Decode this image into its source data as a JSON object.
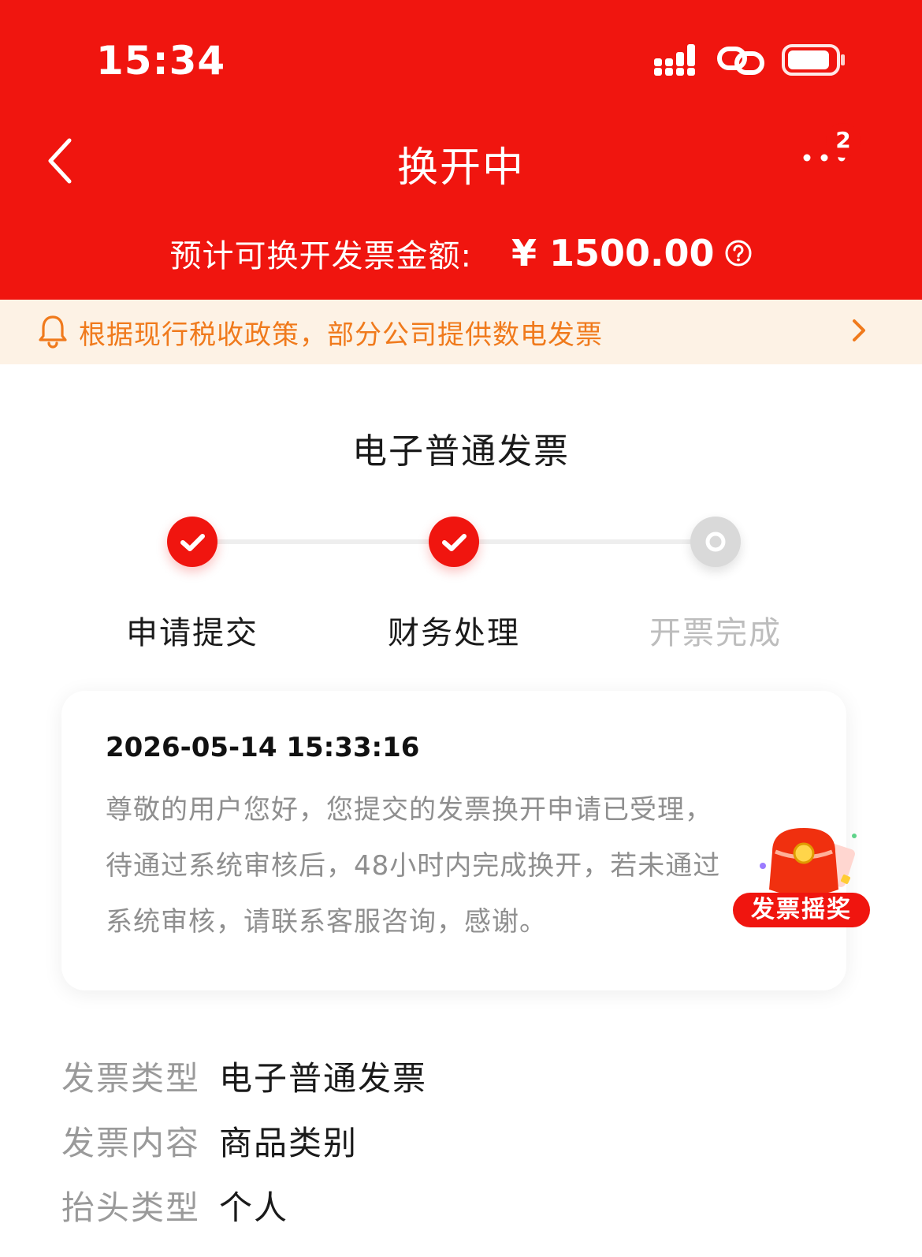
{
  "status_bar": {
    "time": "15:34"
  },
  "nav": {
    "title": "换开中",
    "more_badge": "2"
  },
  "amount": {
    "label": "预计可换开发票金额:",
    "value": "¥ 1500.00"
  },
  "notice": {
    "text": "根据现行税收政策，部分公司提供数电发票"
  },
  "section_title": "电子普通发票",
  "steps": [
    {
      "label": "申请提交",
      "state": "done"
    },
    {
      "label": "财务处理",
      "state": "done"
    },
    {
      "label": "开票完成",
      "state": "pending"
    }
  ],
  "card": {
    "time": "2026-05-14 15:33:16",
    "lines": [
      "尊敬的用户您好，您提交的发票换开申请已受理，",
      "待通过系统审核后，48小时内完成换开，若未通过",
      "系统审核，请联系客服咨询，感谢。"
    ]
  },
  "lottery": {
    "label": "发票摇奖"
  },
  "info": [
    {
      "label": "发票类型",
      "value": "电子普通发票"
    },
    {
      "label": "发票内容",
      "value": "商品类别"
    },
    {
      "label": "抬头类型",
      "value": "个人"
    }
  ],
  "colors": {
    "brand_red": "#f0150f",
    "notice_bg": "#fdf2e5",
    "notice_text": "#f07a1c"
  }
}
